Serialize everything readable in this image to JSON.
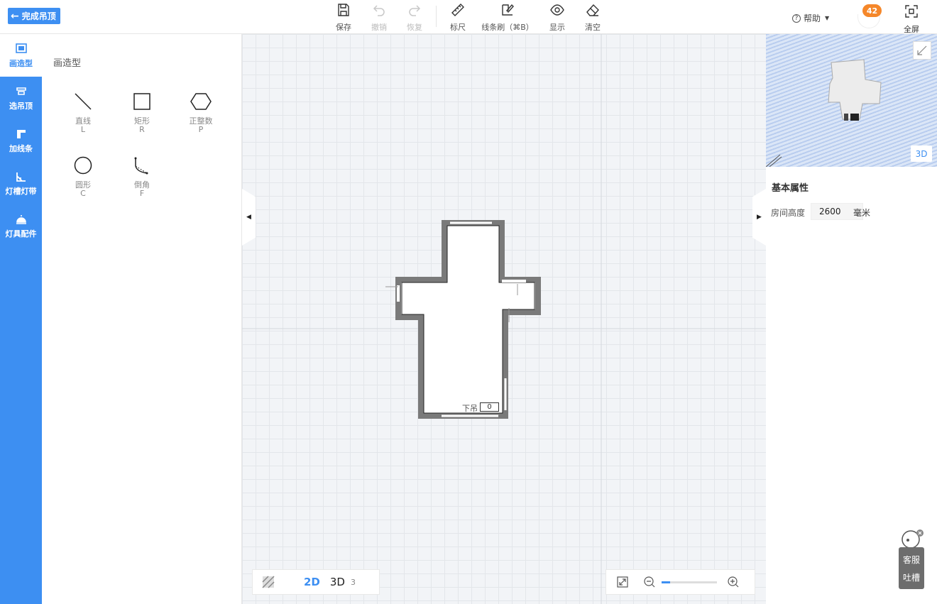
{
  "topbar": {
    "done_label": "完成吊顶",
    "tools": {
      "save": "保存",
      "undo": "撤销",
      "redo": "恢复",
      "ruler": "标尺",
      "line_brush": "线条刷（⌘B）",
      "display": "显示",
      "clear": "清空"
    },
    "help_label": "帮助",
    "notification_count": "42",
    "fullscreen_label": "全屏"
  },
  "rail": {
    "items": [
      {
        "label": "画造型",
        "active": true
      },
      {
        "label": "选吊顶"
      },
      {
        "label": "加线条"
      },
      {
        "label": "灯槽灯带"
      },
      {
        "label": "灯具配件"
      }
    ]
  },
  "panel": {
    "title": "画造型",
    "shapes": [
      {
        "name": "直线",
        "key": "L",
        "icon": "line-icon"
      },
      {
        "name": "矩形",
        "key": "R",
        "icon": "rectangle-icon"
      },
      {
        "name": "正整数",
        "key": "P",
        "icon": "hexagon-icon"
      },
      {
        "name": "圆形",
        "key": "C",
        "icon": "circle-icon"
      },
      {
        "name": "倒角",
        "key": "F",
        "icon": "chamfer-icon"
      }
    ]
  },
  "canvas": {
    "drop_label": "下吊",
    "drop_value": "0"
  },
  "view_controls": {
    "mode_2d": "2D",
    "mode_3d": "3D",
    "level": "3",
    "zoom_fraction": 0.15
  },
  "preview": {
    "button_3d": "3D"
  },
  "properties": {
    "title": "基本属性",
    "room_height_label": "房间高度",
    "room_height_value": "2600",
    "unit": "毫米"
  },
  "customer_service": {
    "line1": "客服",
    "line2": "吐槽"
  },
  "colors": {
    "accent": "#3d8ff2",
    "badge": "#f5872a"
  }
}
